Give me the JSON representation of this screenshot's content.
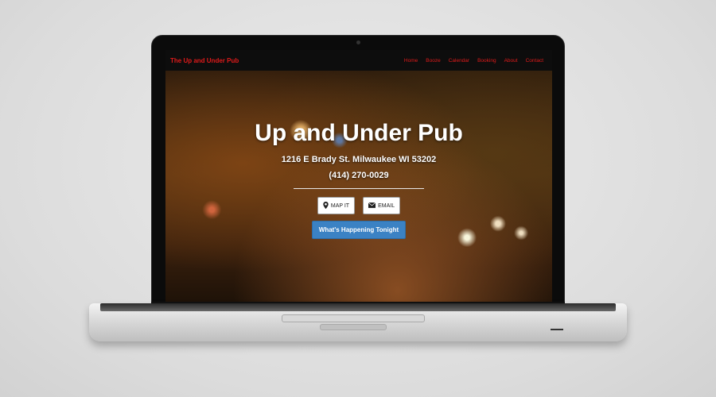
{
  "navbar": {
    "brand": "The Up and Under Pub",
    "links": [
      "Home",
      "Booze",
      "Calendar",
      "Booking",
      "About",
      "Contact"
    ]
  },
  "hero": {
    "title": "Up and Under Pub",
    "address": "1216 E Brady St. Milwaukee WI 53202",
    "phone": "(414) 270-0029",
    "map_button": "MAP IT",
    "email_button": "EMAIL",
    "cta_button": "What's Happening Tonight"
  },
  "icons": {
    "map": "map-marker-icon",
    "email": "envelope-icon"
  },
  "colors": {
    "brand_red": "#e01a1a",
    "cta_blue": "#3b82c4",
    "navbar_bg": "#0d0d0d"
  }
}
